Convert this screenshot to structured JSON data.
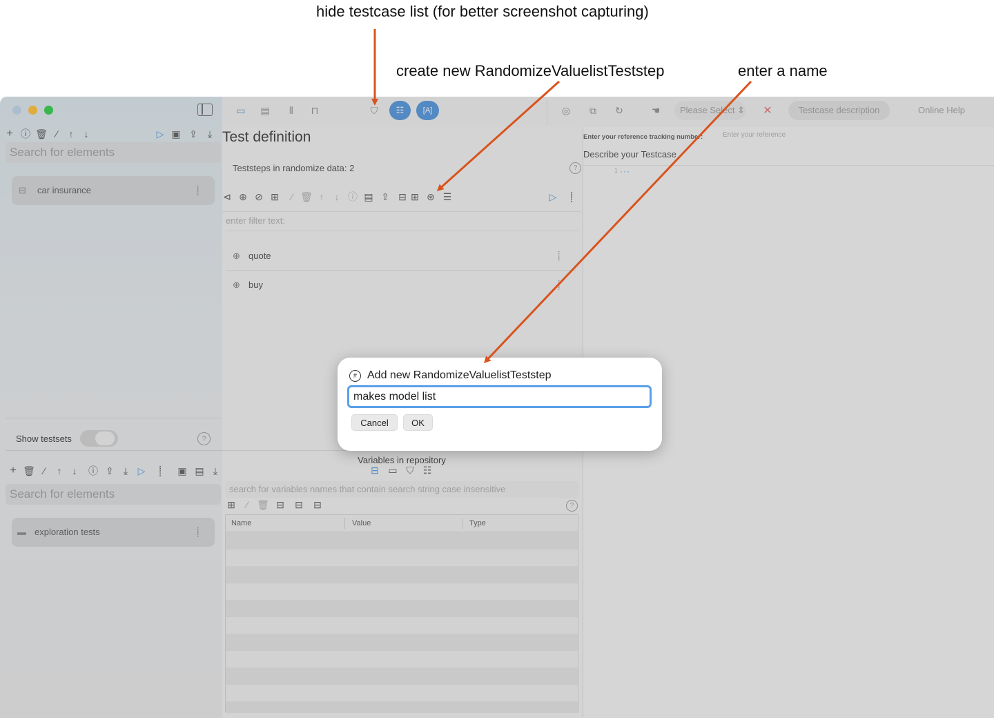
{
  "annotations": {
    "hide_list": "hide testcase list (for better screenshot capturing)",
    "create_new": "create new RandomizeValuelistTeststep",
    "enter_name": "enter a name"
  },
  "colors": {
    "arrow": "#d9531e",
    "accent": "#4a90d9",
    "close_red": "#ff5f57",
    "min_yellow": "#febc2e",
    "max_green": "#28c840"
  },
  "toolbar": {
    "please_select": "Please Select",
    "testcase_description": "Testcase description",
    "online_help": "Online Help"
  },
  "sidebar": {
    "search_placeholder": "Search for elements",
    "items": [
      {
        "label": "car insurance"
      }
    ],
    "show_testsets_label": "Show testsets",
    "show_testsets_on": false,
    "search2_placeholder": "Search for elements",
    "items2": [
      {
        "label": "exploration tests"
      }
    ]
  },
  "center": {
    "title": "Test definition",
    "steps_count_label": "Teststeps in randomize data: 2",
    "filter_placeholder": "enter filter text:",
    "steps": [
      {
        "label": "quote"
      },
      {
        "label": "buy"
      }
    ],
    "variables_title": "Variables in repository",
    "variables_search_placeholder": "search for variables names that contain search string case insensitive",
    "columns": [
      "Name",
      "Value",
      "Type"
    ]
  },
  "right": {
    "tracking_label": "Enter your reference tracking number:",
    "tracking_placeholder": "Enter your reference",
    "describe_label": "Describe your Testcase",
    "editor_line": "1"
  },
  "modal": {
    "title": "Add new RandomizeValuelistTeststep",
    "input_value": "makes model list",
    "cancel": "Cancel",
    "ok": "OK"
  }
}
